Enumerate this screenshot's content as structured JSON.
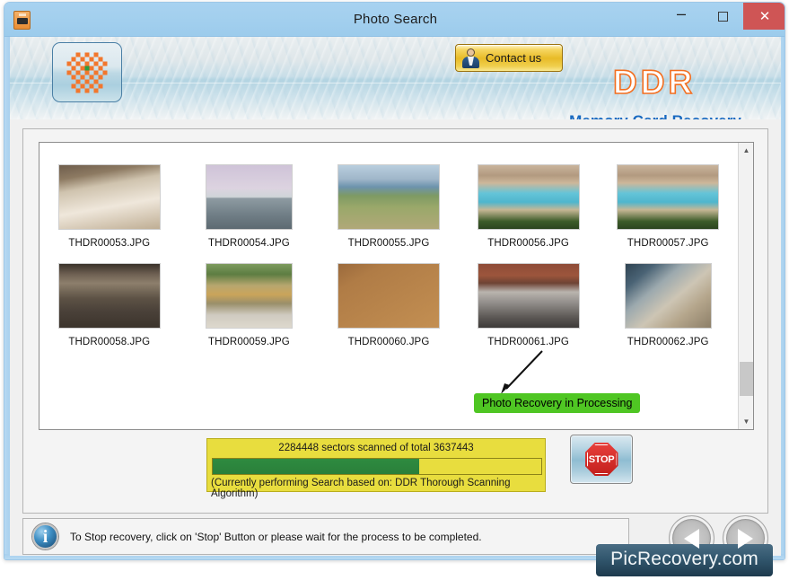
{
  "window": {
    "title": "Photo Search",
    "app_icon": "memory-card-icon",
    "minimize_label": "–",
    "maximize_label": "",
    "close_label": "✕"
  },
  "header": {
    "logo_icon": "checkered-flower-logo",
    "contact_button": "Contact us",
    "contact_icon": "user-avatar-icon",
    "brand": "DDR",
    "subtitle": "Memory Card Recovery",
    "brand_color": "#f36f21",
    "subtitle_color": "#1769c0"
  },
  "thumbnails": [
    {
      "name": "THDR00053.JPG",
      "scene": "buffet-food-table"
    },
    {
      "name": "THDR00054.JPG",
      "scene": "cruise-ship-at-sea"
    },
    {
      "name": "THDR00055.JPG",
      "scene": "beach-playground"
    },
    {
      "name": "THDR00056.JPG",
      "scene": "resort-swimming-pool"
    },
    {
      "name": "THDR00057.JPG",
      "scene": "resort-swimming-pool"
    },
    {
      "name": "THDR00058.JPG",
      "scene": "hotel-lobby-interior"
    },
    {
      "name": "THDR00059.JPG",
      "scene": "building-exterior-trees"
    },
    {
      "name": "THDR00060.JPG",
      "scene": "decorated-cupcakes-plate"
    },
    {
      "name": "THDR00061.JPG",
      "scene": "marathon-street-crowd"
    },
    {
      "name": "THDR00062.JPG",
      "scene": "ship-atrium-staircase"
    }
  ],
  "scrollbar": {
    "up_arrow": "▲",
    "down_arrow": "▼"
  },
  "progress": {
    "scanned_sectors": 2284448,
    "total_sectors": 3637443,
    "status_line": "2284448 sectors scanned of total 3637443",
    "algorithm_line": "(Currently performing Search based on:  DDR Thorough Scanning Algorithm)",
    "percent": 62.8,
    "bar_fill_color": "#2e8b40",
    "panel_color": "#e8dd3e"
  },
  "stop_button": {
    "label": "STOP",
    "icon": "stop-sign-icon"
  },
  "info_bar": {
    "icon": "info-icon",
    "message": "To Stop recovery, click on 'Stop' Button or please wait for the process to be completed."
  },
  "tooltip": {
    "text": "Photo Recovery in Processing",
    "color": "#4fc623"
  },
  "nav": {
    "previous_icon": "previous-arrow-icon",
    "next_icon": "next-arrow-icon"
  },
  "watermark": {
    "text": "PicRecovery.com"
  }
}
